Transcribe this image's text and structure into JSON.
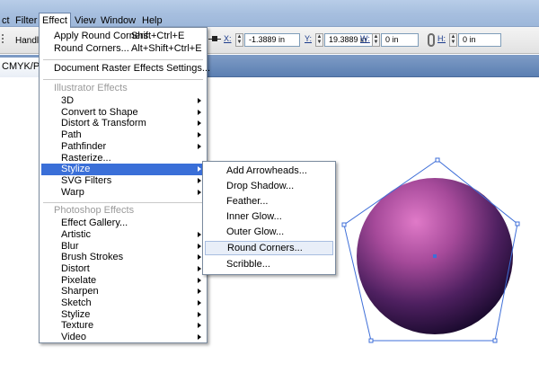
{
  "menubar": {
    "items": [
      {
        "label": "ct"
      },
      {
        "label": "Filter"
      },
      {
        "label": "Effect"
      },
      {
        "label": "View"
      },
      {
        "label": "Window"
      },
      {
        "label": "Help"
      }
    ]
  },
  "controlbar": {
    "handle_label": "Handle",
    "x_label": "X:",
    "x_value": "-1.3889 in",
    "y_label": "Y:",
    "y_value": "19.3889 in",
    "w_label": "W:",
    "w_value": "0 in",
    "h_label": "H:",
    "h_value": "0 in"
  },
  "tab": {
    "doc_label": "CMYK/Pre"
  },
  "effect_menu": {
    "items": [
      {
        "label": "Apply Round Corners",
        "shortcut": "Shift+Ctrl+E"
      },
      {
        "label": "Round Corners...",
        "shortcut": "Alt+Shift+Ctrl+E"
      },
      {
        "label": "Document Raster Effects Settings..."
      },
      {
        "label": "Illustrator Effects"
      },
      {
        "label": "3D"
      },
      {
        "label": "Convert to Shape"
      },
      {
        "label": "Distort & Transform"
      },
      {
        "label": "Path"
      },
      {
        "label": "Pathfinder"
      },
      {
        "label": "Rasterize..."
      },
      {
        "label": "Stylize"
      },
      {
        "label": "SVG Filters"
      },
      {
        "label": "Warp"
      },
      {
        "label": "Photoshop Effects"
      },
      {
        "label": "Effect Gallery..."
      },
      {
        "label": "Artistic"
      },
      {
        "label": "Blur"
      },
      {
        "label": "Brush Strokes"
      },
      {
        "label": "Distort"
      },
      {
        "label": "Pixelate"
      },
      {
        "label": "Sharpen"
      },
      {
        "label": "Sketch"
      },
      {
        "label": "Stylize"
      },
      {
        "label": "Texture"
      },
      {
        "label": "Video"
      }
    ]
  },
  "stylize_submenu": {
    "items": [
      {
        "label": "Add Arrowheads..."
      },
      {
        "label": "Drop Shadow..."
      },
      {
        "label": "Feather..."
      },
      {
        "label": "Inner Glow..."
      },
      {
        "label": "Outer Glow..."
      },
      {
        "label": "Round Corners..."
      },
      {
        "label": "Scribble..."
      }
    ]
  },
  "colors": {
    "highlight": "#3a6fd8",
    "sphere_light": "#e07ac8",
    "sphere_dark": "#1a0a2e",
    "selection": "#3f6fd8"
  }
}
